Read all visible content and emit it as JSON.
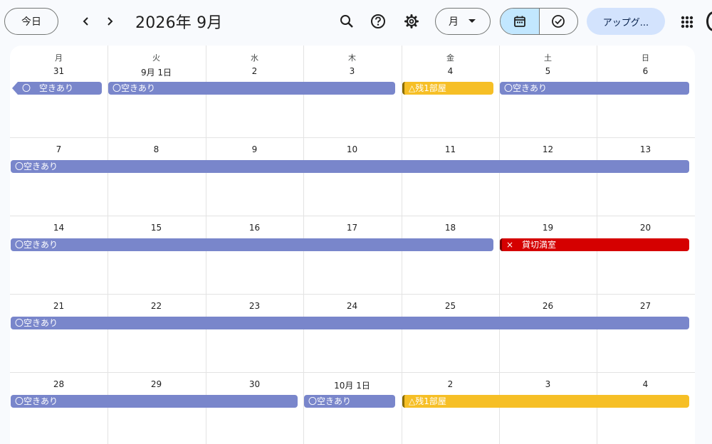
{
  "toolbar": {
    "today_label": "今日",
    "title": "2026年 9月",
    "view_label": "月",
    "upgrade_label": "アップグ..."
  },
  "weekdays": [
    "月",
    "火",
    "水",
    "木",
    "金",
    "土",
    "日"
  ],
  "weeks": [
    {
      "days": [
        "31",
        "9月 1日",
        "2",
        "3",
        "4",
        "5",
        "6"
      ],
      "events": [
        {
          "label": "〇　空きあり",
          "start": 0,
          "span": 1,
          "color": "blue",
          "continues_before": true
        },
        {
          "label": "〇空きあり",
          "start": 1,
          "span": 3,
          "color": "blue"
        },
        {
          "label": "△残1部屋",
          "start": 4,
          "span": 1,
          "color": "yellow"
        },
        {
          "label": "〇空きあり",
          "start": 5,
          "span": 2,
          "color": "blue"
        }
      ]
    },
    {
      "days": [
        "7",
        "8",
        "9",
        "10",
        "11",
        "12",
        "13"
      ],
      "events": [
        {
          "label": "〇空きあり",
          "start": 0,
          "span": 7,
          "color": "blue"
        }
      ]
    },
    {
      "days": [
        "14",
        "15",
        "16",
        "17",
        "18",
        "19",
        "20"
      ],
      "events": [
        {
          "label": "〇空きあり",
          "start": 0,
          "span": 5,
          "color": "blue"
        },
        {
          "label": "×　貸切満室",
          "start": 5,
          "span": 2,
          "color": "red"
        }
      ]
    },
    {
      "days": [
        "21",
        "22",
        "23",
        "24",
        "25",
        "26",
        "27"
      ],
      "events": [
        {
          "label": "〇空きあり",
          "start": 0,
          "span": 7,
          "color": "blue"
        }
      ]
    },
    {
      "days": [
        "28",
        "29",
        "30",
        "10月 1日",
        "2",
        "3",
        "4"
      ],
      "events": [
        {
          "label": "〇空きあり",
          "start": 0,
          "span": 3,
          "color": "blue"
        },
        {
          "label": "〇空きあり",
          "start": 3,
          "span": 1,
          "color": "blue"
        },
        {
          "label": "△残1部屋",
          "start": 4,
          "span": 3,
          "color": "yellow"
        }
      ]
    }
  ],
  "colors": {
    "blue": "#7986cb",
    "yellow": "#f6bf26",
    "red": "#d50000",
    "accent": "#c2e7ff"
  }
}
